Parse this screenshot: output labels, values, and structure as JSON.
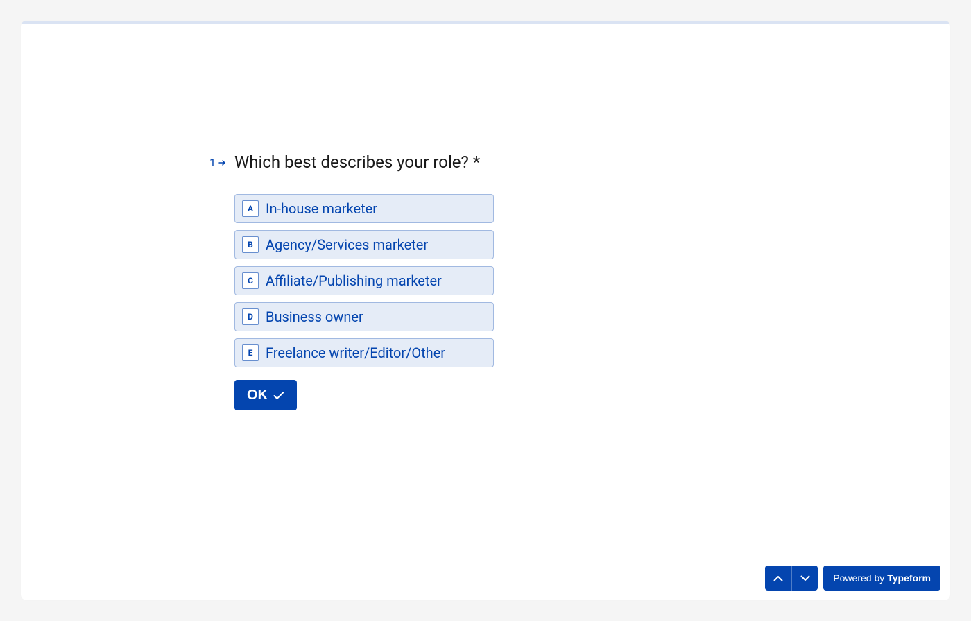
{
  "question": {
    "number": "1",
    "title": "Which best describes your role? *",
    "options": [
      {
        "key": "A",
        "label": "In-house marketer"
      },
      {
        "key": "B",
        "label": "Agency/Services marketer"
      },
      {
        "key": "C",
        "label": "Affiliate/Publishing marketer"
      },
      {
        "key": "D",
        "label": "Business owner"
      },
      {
        "key": "E",
        "label": "Freelance writer/Editor/Other"
      }
    ]
  },
  "ok_label": "OK",
  "footer": {
    "powered_prefix": "Powered by ",
    "powered_brand": "Typeform"
  }
}
